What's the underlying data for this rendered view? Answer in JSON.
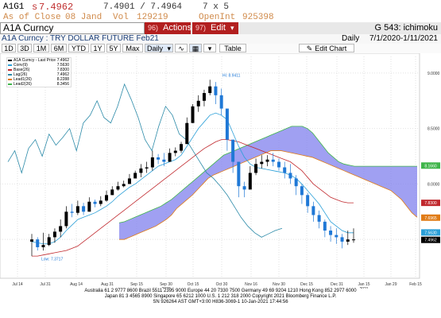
{
  "quote": {
    "ticker": "A1G1",
    "last_prefix": "s",
    "last": "7.4962",
    "bid_ask": "7.4901 / 7.4964",
    "size": "7 x 5",
    "close_label": "As of Close",
    "close_date": "08 Jand",
    "vol_label": "Vol",
    "vol": "129219",
    "oi_label": "OpenInt",
    "oi": "925398"
  },
  "toolbar": {
    "security": "A1A Curncy",
    "actions_num": "96)",
    "actions_label": "Actions",
    "edit_num": "97)",
    "edit_label": "Edit",
    "study": "G 543: ichimoku"
  },
  "subtitle": {
    "security_desc": "A1A Curncy : TRY DOLLAR FUTURE Feb21",
    "period": "Daily",
    "range": "7/1/2020-1/11/2021"
  },
  "tabs": [
    "1D",
    "3D",
    "1M",
    "6M",
    "YTD",
    "1Y",
    "5Y",
    "Max"
  ],
  "controls": {
    "freq": "Daily",
    "table": "Table",
    "edit_chart": "Edit Chart"
  },
  "legend": [
    {
      "name": "A1A Curncy - Last Price",
      "value": "7.4962",
      "color": "#000000"
    },
    {
      "name": "Conv(9)",
      "value": "7.5630",
      "color": "#2a9fd8"
    },
    {
      "name": "Base(26)",
      "value": "7.8300",
      "color": "#c0282d"
    },
    {
      "name": "Lag(26)",
      "value": "7.4962",
      "color": "#2b8aa8"
    },
    {
      "name": "Lead1(26)",
      "value": "8.2288",
      "color": "#e07b16"
    },
    {
      "name": "Lead2(26)",
      "value": "8.3456",
      "color": "#3fb54a"
    }
  ],
  "chart_data": {
    "type": "line",
    "x_ticks": [
      "Jul 14",
      "Jul 31",
      "Aug 14",
      "Aug 31",
      "Sep 15",
      "Sep 30",
      "Oct 15",
      "Oct 30",
      "Nov 16",
      "Nov 30",
      "Dec 15",
      "Dec 31",
      "Jan 15",
      "Jan 29",
      "Feb 15"
    ],
    "year_labels": [
      "2020",
      "2021"
    ],
    "y_ticks": [
      "9.0000",
      "8.5000",
      "8.0000",
      "7.5000"
    ],
    "ylim": [
      7.15,
      9.15
    ],
    "annotations": {
      "high": "Hi: 8.9411",
      "low": "Low: 7.3717"
    },
    "axis_badges": [
      {
        "value": "8.1660",
        "color": "#3fb54a"
      },
      {
        "value": "7.8300",
        "color": "#c0282d"
      },
      {
        "value": "7.6965",
        "color": "#e07b16"
      },
      {
        "value": "7.5630",
        "color": "#2a9fd8"
      },
      {
        "value": "7.4962",
        "color": "#000000"
      }
    ],
    "candles": [
      [
        7.55,
        7.35,
        7.5
      ],
      [
        7.52,
        7.4,
        7.43
      ],
      [
        7.56,
        7.4,
        7.45
      ],
      [
        7.55,
        7.44,
        7.52
      ],
      [
        7.6,
        7.47,
        7.57
      ],
      [
        7.68,
        7.52,
        7.62
      ],
      [
        7.8,
        7.6,
        7.75
      ],
      [
        7.82,
        7.7,
        7.74
      ],
      [
        7.85,
        7.72,
        7.8
      ],
      [
        7.83,
        7.72,
        7.75
      ],
      [
        7.88,
        7.78,
        7.84
      ],
      [
        7.86,
        7.79,
        7.82
      ],
      [
        7.89,
        7.8,
        7.85
      ],
      [
        7.94,
        7.84,
        7.9
      ],
      [
        7.98,
        7.9,
        7.95
      ],
      [
        8.02,
        7.94,
        7.98
      ],
      [
        8.03,
        7.97,
        8.0
      ],
      [
        8.09,
        8.0,
        8.05
      ],
      [
        8.12,
        8.05,
        8.1
      ],
      [
        8.18,
        8.06,
        8.14
      ],
      [
        8.2,
        8.1,
        8.15
      ],
      [
        8.3,
        8.12,
        8.24
      ],
      [
        8.27,
        8.18,
        8.22
      ],
      [
        8.28,
        8.16,
        8.2
      ],
      [
        8.32,
        8.2,
        8.28
      ],
      [
        8.33,
        8.25,
        8.3
      ],
      [
        8.38,
        8.28,
        8.36
      ],
      [
        8.6,
        8.4,
        8.55
      ],
      [
        8.72,
        8.55,
        8.7
      ],
      [
        8.8,
        8.65,
        8.75
      ],
      [
        8.85,
        8.7,
        8.82
      ],
      [
        8.94,
        8.8,
        8.88
      ],
      [
        8.92,
        8.72,
        8.8
      ],
      [
        8.86,
        8.62,
        8.68
      ],
      [
        8.64,
        8.3,
        8.4
      ],
      [
        8.35,
        8.1,
        8.2
      ],
      [
        8.12,
        7.88,
        7.98
      ],
      [
        8.02,
        7.88,
        7.95
      ],
      [
        8.16,
        7.96,
        8.1
      ],
      [
        8.23,
        8.08,
        8.18
      ],
      [
        8.26,
        8.14,
        8.2
      ],
      [
        8.26,
        8.16,
        8.22
      ],
      [
        8.28,
        8.16,
        8.2
      ],
      [
        8.23,
        8.12,
        8.15
      ],
      [
        8.2,
        8.05,
        8.1
      ],
      [
        8.18,
        8.0,
        8.05
      ],
      [
        8.08,
        7.9,
        7.98
      ],
      [
        8.0,
        7.82,
        7.9
      ],
      [
        7.92,
        7.74,
        7.8
      ],
      [
        7.84,
        7.66,
        7.72
      ],
      [
        7.76,
        7.6,
        7.66
      ],
      [
        7.68,
        7.52,
        7.58
      ],
      [
        7.62,
        7.48,
        7.54
      ],
      [
        7.6,
        7.46,
        7.52
      ],
      [
        7.55,
        7.42,
        7.48
      ],
      [
        7.58,
        7.45,
        7.5
      ],
      [
        7.6,
        7.47,
        7.5
      ]
    ],
    "series": [
      {
        "name": "Conv(9)",
        "color": "#2a9fd8",
        "values": [
          7.48,
          7.47,
          7.46,
          7.46,
          7.48,
          7.52,
          7.58,
          7.63,
          7.68,
          7.7,
          7.72,
          7.74,
          7.77,
          7.8,
          7.84,
          7.89,
          7.93,
          7.97,
          8.0,
          8.04,
          8.08,
          8.12,
          8.16,
          8.18,
          8.2,
          8.22,
          8.26,
          8.34,
          8.42,
          8.5,
          8.56,
          8.62,
          8.64,
          8.62,
          8.58,
          8.46,
          8.34,
          8.24,
          8.18,
          8.15,
          8.14,
          8.13,
          8.12,
          8.11,
          8.1,
          8.08,
          8.05,
          8.0,
          7.94,
          7.88,
          7.82,
          7.74,
          7.66,
          7.62,
          7.58,
          7.56,
          7.56
        ]
      },
      {
        "name": "Base(26)",
        "color": "#c0282d",
        "values": [
          7.35,
          7.35,
          7.36,
          7.37,
          7.38,
          7.39,
          7.4,
          7.42,
          7.44,
          7.48,
          7.52,
          7.56,
          7.6,
          7.64,
          7.68,
          7.72,
          7.76,
          7.8,
          7.84,
          7.88,
          7.92,
          7.96,
          8.0,
          8.04,
          8.08,
          8.12,
          8.16,
          8.2,
          8.24,
          8.28,
          8.32,
          8.35,
          8.38,
          8.4,
          8.4,
          8.39,
          8.38,
          8.36,
          8.34,
          8.32,
          8.3,
          8.28,
          8.26,
          8.24,
          8.22,
          8.2,
          8.16,
          8.12,
          8.06,
          8.0,
          7.96,
          7.92,
          7.88,
          7.86,
          7.84,
          7.83,
          7.83
        ]
      },
      {
        "name": "Lag(26)",
        "color": "#2b8aa8",
        "values": [
          8.2,
          8.3,
          8.1,
          8.32,
          8.4,
          8.25,
          8.45,
          8.35,
          8.42,
          8.5,
          8.3,
          8.55,
          8.62,
          8.75,
          8.6,
          8.55,
          8.7,
          8.9,
          8.76,
          8.6,
          8.4,
          8.3,
          8.52,
          8.7,
          8.62,
          8.45,
          8.4,
          8.3,
          8.2,
          8.1,
          8.05,
          7.98,
          7.9,
          7.8,
          7.7,
          7.62,
          7.56,
          7.52,
          7.55,
          7.58,
          7.6
        ]
      },
      {
        "name": "Lead1(26)",
        "color": "#e07b16",
        "values": [
          7.5,
          7.5,
          7.52,
          7.54,
          7.56,
          7.58,
          7.6,
          7.62,
          7.65,
          7.68,
          7.72,
          7.78,
          7.82,
          7.86,
          7.9,
          7.95,
          8.0,
          8.05,
          8.08,
          8.1,
          8.12,
          8.14,
          8.16,
          8.18,
          8.2,
          8.22,
          8.24,
          8.26,
          8.28,
          8.3,
          8.3,
          8.3,
          8.29,
          8.28,
          8.27,
          8.26,
          8.25,
          8.24,
          8.22,
          8.2,
          8.18,
          8.16,
          8.14,
          8.12,
          8.1,
          8.08,
          8.06,
          8.04,
          8.02,
          8.0,
          7.98,
          7.96,
          7.94,
          7.9,
          7.86,
          7.8,
          7.74,
          7.7
        ]
      },
      {
        "name": "Lead2(26)",
        "color": "#3fb54a",
        "values": [
          7.65,
          7.66,
          7.68,
          7.7,
          7.72,
          7.74,
          7.76,
          7.78,
          7.8,
          7.83,
          7.86,
          7.9,
          7.94,
          7.98,
          8.02,
          8.06,
          8.1,
          8.14,
          8.18,
          8.22,
          8.26,
          8.28,
          8.3,
          8.32,
          8.34,
          8.36,
          8.38,
          8.4,
          8.42,
          8.44,
          8.46,
          8.48,
          8.5,
          8.52,
          8.52,
          8.52,
          8.5,
          8.46,
          8.4,
          8.34,
          8.28,
          8.24,
          8.2,
          8.18,
          8.17,
          8.16,
          8.16,
          8.16,
          8.16,
          8.16,
          8.16,
          8.16,
          8.16,
          8.16,
          8.16,
          8.16,
          8.16,
          8.16
        ]
      }
    ],
    "cloud_fill": "#8080ee"
  },
  "footer": {
    "line1": "Australia 61 2 9777 8600 Brazil 5511 2395 9000 Europe 44 20 7330 7500 Germany 49 69 9204 1210 Hong Kong 852 2977 6000",
    "line2": "Japan 81 3 4565 8900          Singapore 65 6212 1000          U.S. 1 212 318 2000          Copyright 2021 Bloomberg Finance L.P.",
    "line3": "SN 926264 AST  GMT+3:00 H836-3069-1 10-Jan-2021 17:44:56"
  }
}
